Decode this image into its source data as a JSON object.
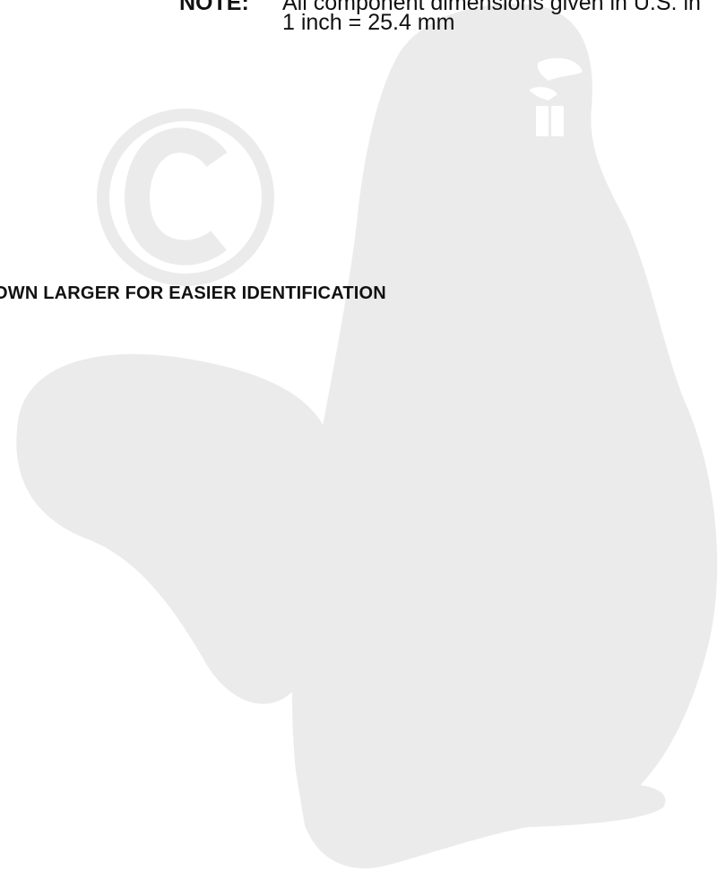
{
  "note": {
    "label": "NOTE:",
    "line1": "All component dimensions given in U.S. in",
    "line2": "1 inch = 25.4 mm"
  },
  "heading": "OWN LARGER FOR EASIER IDENTIFICATION",
  "watermark": {
    "icon": "beaver-copyright-watermark",
    "color": "#ebebeb"
  }
}
